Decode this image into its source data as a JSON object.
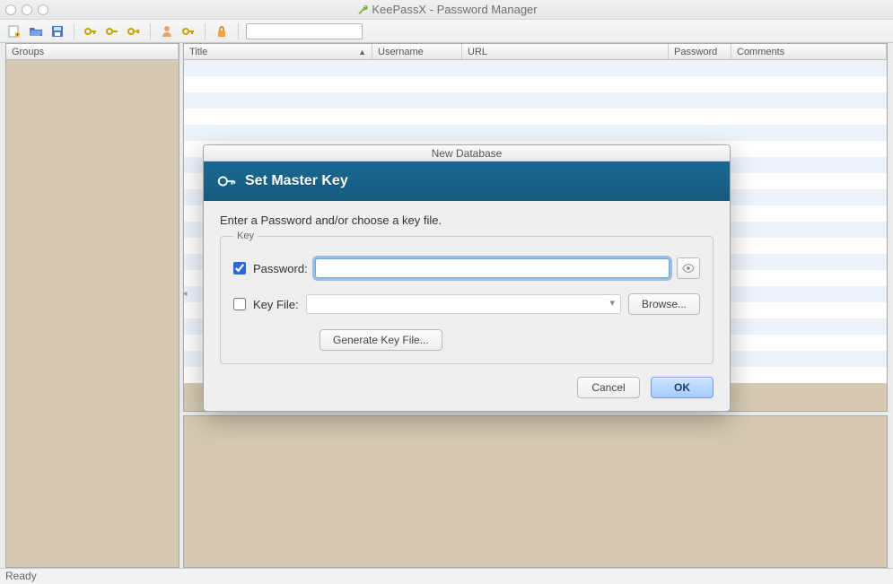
{
  "window": {
    "title": "KeePassX - Password Manager"
  },
  "toolbar": {
    "search_placeholder": ""
  },
  "sidebar": {
    "header": "Groups"
  },
  "list": {
    "columns": {
      "title": "Title",
      "username": "Username",
      "url": "URL",
      "password": "Password",
      "comments": "Comments"
    }
  },
  "statusbar": {
    "text": "Ready"
  },
  "dialog": {
    "window_title": "New Database",
    "banner_title": "Set Master Key",
    "instruction": "Enter a Password and/or choose a key file.",
    "legend": "Key",
    "password_label": "Password:",
    "password_checked": true,
    "keyfile_label": "Key File:",
    "keyfile_checked": false,
    "browse_label": "Browse...",
    "generate_label": "Generate Key File...",
    "cancel_label": "Cancel",
    "ok_label": "OK"
  }
}
